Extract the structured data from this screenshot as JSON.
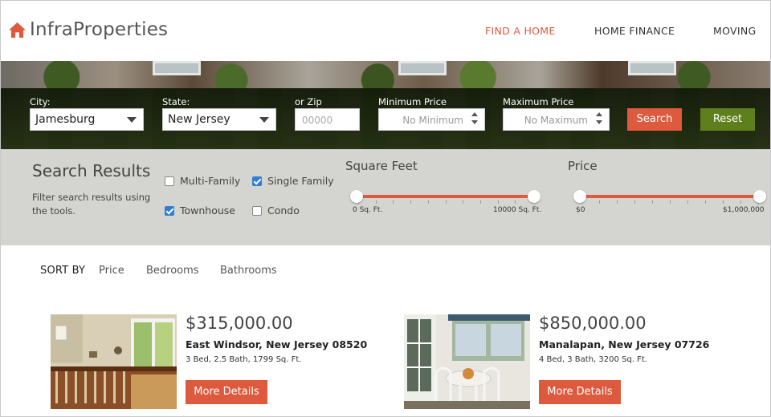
{
  "brand": {
    "name": "InfraProperties",
    "icon": "house-icon"
  },
  "nav": [
    {
      "label": "FIND A HOME",
      "active": true
    },
    {
      "label": "HOME FINANCE",
      "active": false
    },
    {
      "label": "MOVING",
      "active": false
    }
  ],
  "search": {
    "city_label": "City:",
    "city_value": "Jamesburg",
    "state_label": "State:",
    "state_value": "New Jersey",
    "zip_label": "or Zip",
    "zip_placeholder": "00000",
    "min_price_label": "Minimum Price",
    "min_price_placeholder": "No Minimum",
    "max_price_label": "Maximum Price",
    "max_price_placeholder": "No Maximum",
    "search_button": "Search",
    "reset_button": "Reset"
  },
  "filters": {
    "title": "Search Results",
    "subtitle": "Filter search results using the tools.",
    "checkboxes": [
      {
        "label": "Multi-Family",
        "checked": false
      },
      {
        "label": "Single Family",
        "checked": true
      },
      {
        "label": "Townhouse",
        "checked": true
      },
      {
        "label": "Condo",
        "checked": false
      }
    ],
    "square_feet": {
      "title": "Square Feet",
      "min_label": "0 Sq. Ft.",
      "max_label": "10000 Sq. Ft.",
      "low": 0.0,
      "high": 1.0
    },
    "price": {
      "title": "Price",
      "min_label": "$0",
      "max_label": "$1,000,000",
      "low": 0.0,
      "high": 1.0
    }
  },
  "sort": {
    "label": "SORT BY",
    "options": [
      "Price",
      "Bedrooms",
      "Bathrooms"
    ]
  },
  "listings": [
    {
      "price": "$315,000.00",
      "location": "East Windsor,  New Jersey 08520",
      "specs": "3 Bed, 2.5 Bath, 1799 Sq. Ft.",
      "button": "More Details"
    },
    {
      "price": "$850,000.00",
      "location": "Manalapan,  New Jersey 07726",
      "specs": "4 Bed, 3 Bath, 3200 Sq. Ft.",
      "button": "More Details"
    }
  ],
  "colors": {
    "accent": "#dd5a3e",
    "reset": "#5e7f1c",
    "checkbox": "#2f7ed8",
    "filter_band": "#d4d4d0"
  }
}
